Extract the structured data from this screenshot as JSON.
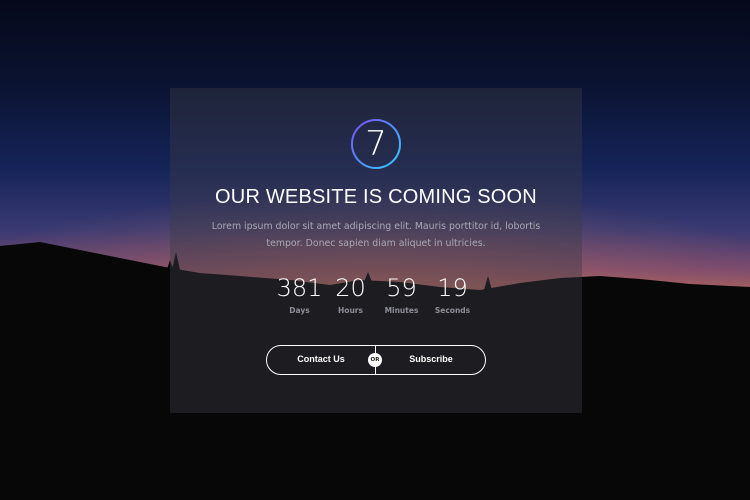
{
  "logo": {
    "digit": "7"
  },
  "heading": "OUR WEBSITE IS COMING SOON",
  "description": "Lorem ipsum dolor sit amet adipiscing elit. Mauris porttitor id, lobortis tempor. Donec sapien diam aliquet in ultricies.",
  "countdown": [
    {
      "value": "381",
      "label": "Days"
    },
    {
      "value": "20",
      "label": "Hours"
    },
    {
      "value": "59",
      "label": "Minutes"
    },
    {
      "value": "19",
      "label": "Seconds"
    }
  ],
  "actions": {
    "contact_label": "Contact Us",
    "or_label": "OR",
    "subscribe_label": "Subscribe"
  },
  "colors": {
    "panel": "#3c3c46",
    "text": "#ffffff",
    "muted": "#a9a9b3",
    "logo_gradient_start": "#7b4cff",
    "logo_gradient_end": "#2fd0ff"
  }
}
